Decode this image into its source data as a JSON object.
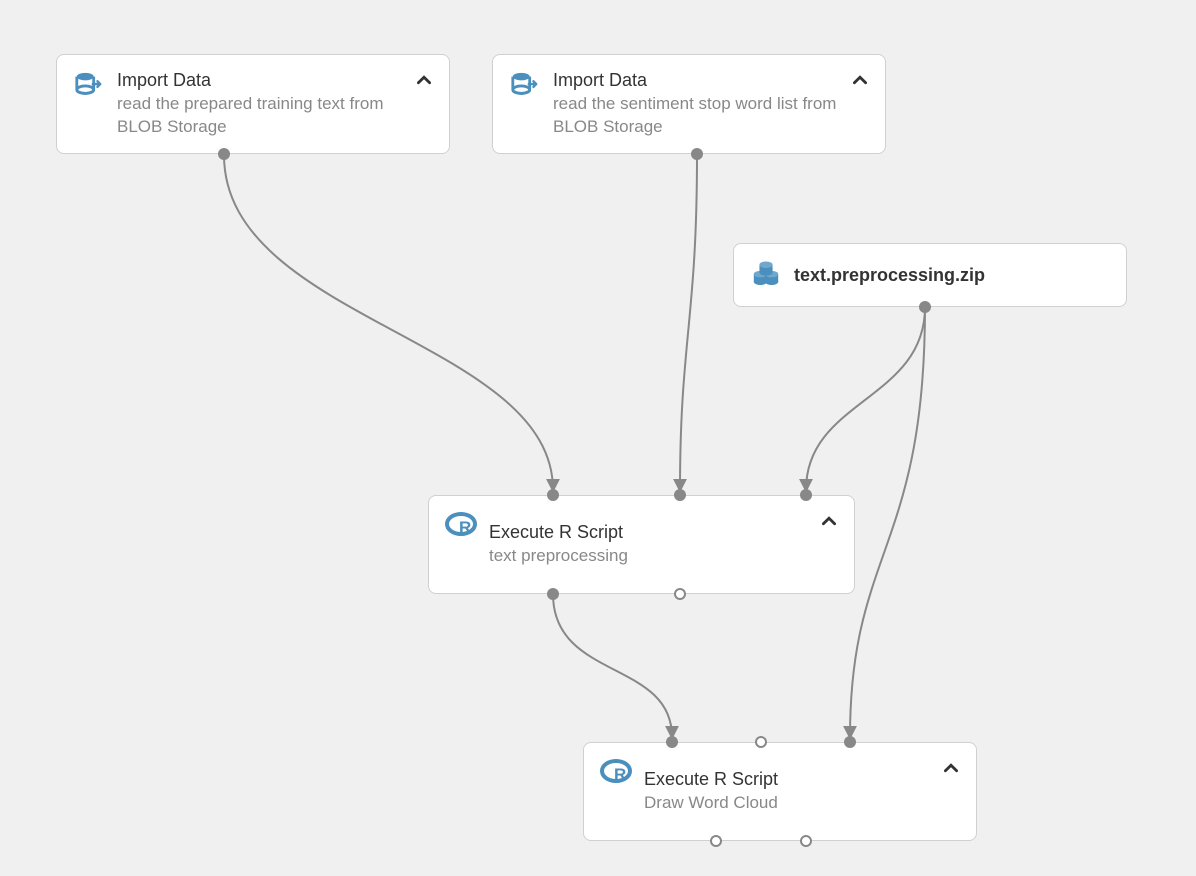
{
  "nodes": {
    "import1": {
      "title": "Import Data",
      "desc": "read the prepared training text from BLOB Storage"
    },
    "import2": {
      "title": "Import Data",
      "desc": "read the sentiment stop word list from BLOB Storage"
    },
    "zip": {
      "title": "text.preprocessing.zip"
    },
    "exec1": {
      "title": "Execute R Script",
      "desc": "text preprocessing"
    },
    "exec2": {
      "title": "Execute R Script",
      "desc": "Draw Word Cloud"
    }
  }
}
